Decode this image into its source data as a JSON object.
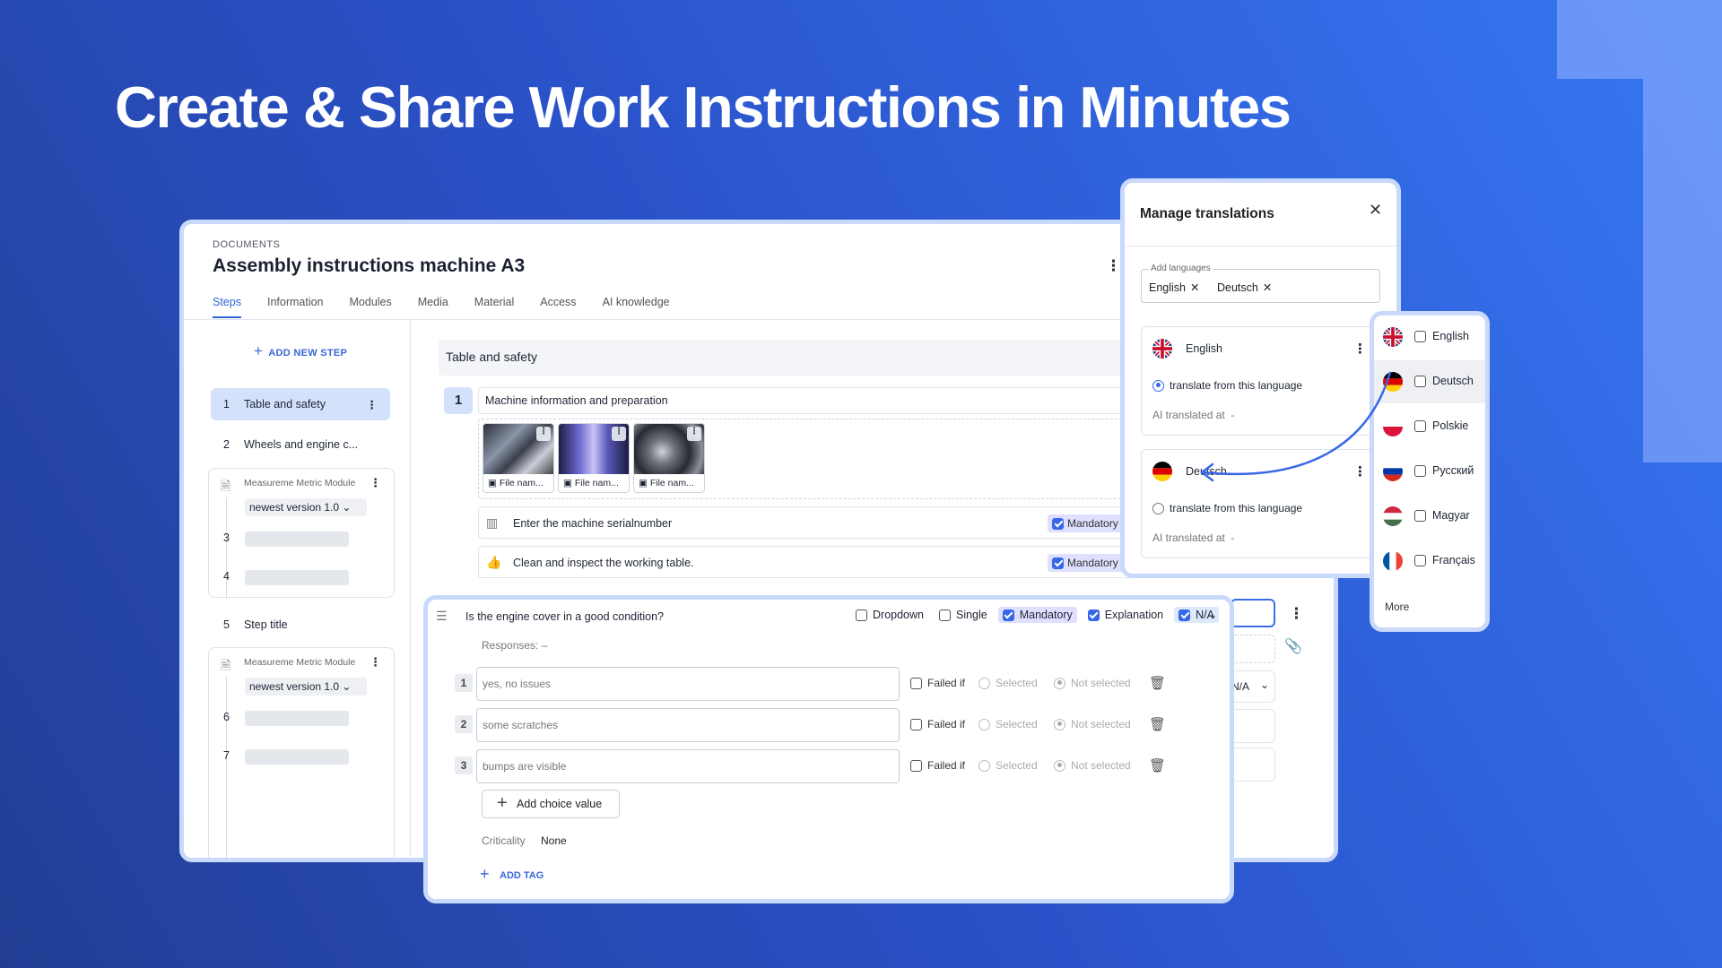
{
  "headline": "Create & Share Work Instructions in Minutes",
  "document": {
    "breadcrumb": "DOCUMENTS",
    "title": "Assembly instructions machine A3",
    "tabs": [
      {
        "label": "Steps",
        "active": true
      },
      {
        "label": "Information"
      },
      {
        "label": "Modules"
      },
      {
        "label": "Media"
      },
      {
        "label": "Material"
      },
      {
        "label": "Access"
      },
      {
        "label": "AI knowledge"
      }
    ]
  },
  "sidebar": {
    "add_step": "ADD NEW STEP",
    "steps": [
      {
        "num": "1",
        "label": "Table and safety",
        "selected": true
      },
      {
        "num": "2",
        "label": "Wheels and engine c..."
      },
      {
        "num": "5",
        "label": "Step title"
      }
    ],
    "modules": [
      {
        "title": "Measureme Metric Module",
        "version": "newest version 1.0",
        "nums": [
          "3",
          "4"
        ]
      },
      {
        "title": "Measureme Metric Module",
        "version": "newest version 1.0",
        "nums": [
          "6",
          "7"
        ]
      }
    ]
  },
  "content": {
    "section_title": "Table and safety",
    "step_number": "1",
    "step_title": "Machine information and preparation",
    "images": [
      {
        "caption": "File nam..."
      },
      {
        "caption": "File nam..."
      },
      {
        "caption": "File nam..."
      }
    ],
    "substeps": [
      {
        "text": "Enter the machine serialnumber",
        "badge": "Mandatory",
        "icon": "barcode-icon"
      },
      {
        "text": "Clean and inspect the working table.",
        "badge": "Mandatory",
        "icon": "thumbs-up-icon"
      }
    ],
    "partial_value": "N/A"
  },
  "question": {
    "text": "Is the engine cover in a good condition?",
    "options": [
      {
        "label": "Dropdown",
        "checked": false
      },
      {
        "label": "Single",
        "checked": false
      },
      {
        "label": "Mandatory",
        "checked": true
      },
      {
        "label": "Explanation",
        "checked": true
      },
      {
        "label": "N/A",
        "checked": true
      }
    ],
    "responses_label": "Responses:",
    "responses_value": "–",
    "responses": [
      {
        "num": "1",
        "value": "yes, no issues"
      },
      {
        "num": "2",
        "value": "some scratches"
      },
      {
        "num": "3",
        "value": "bumps are visible"
      }
    ],
    "failed_if": "Failed if",
    "selected": "Selected",
    "not_selected": "Not selected",
    "add_choice": "Add choice value",
    "criticality_label": "Criticality",
    "criticality_value": "None",
    "add_tag": "ADD TAG"
  },
  "translations": {
    "title": "Manage translations",
    "add_languages_label": "Add languages",
    "chips": [
      "English",
      "Deutsch"
    ],
    "cards": [
      {
        "name": "English",
        "radio_label": "translate from this language",
        "radio_on": true,
        "ai_label": "AI translated at",
        "ai_value": "-"
      },
      {
        "name": "Deutsch",
        "radio_label": "translate from this language",
        "radio_on": false,
        "ai_label": "AI translated at",
        "ai_value": "-"
      }
    ]
  },
  "language_list": {
    "items": [
      {
        "label": "English",
        "flag": "uk"
      },
      {
        "label": "Deutsch",
        "flag": "de",
        "highlighted": true
      },
      {
        "label": "Polskie",
        "flag": "pl"
      },
      {
        "label": "Русский",
        "flag": "ru"
      },
      {
        "label": "Magyar",
        "flag": "hu"
      },
      {
        "label": "Français",
        "flag": "fr"
      }
    ],
    "more": "More"
  },
  "colors": {
    "accent": "#3768e8",
    "selection": "#d4e1fb",
    "badge": "#dfe0ff"
  }
}
